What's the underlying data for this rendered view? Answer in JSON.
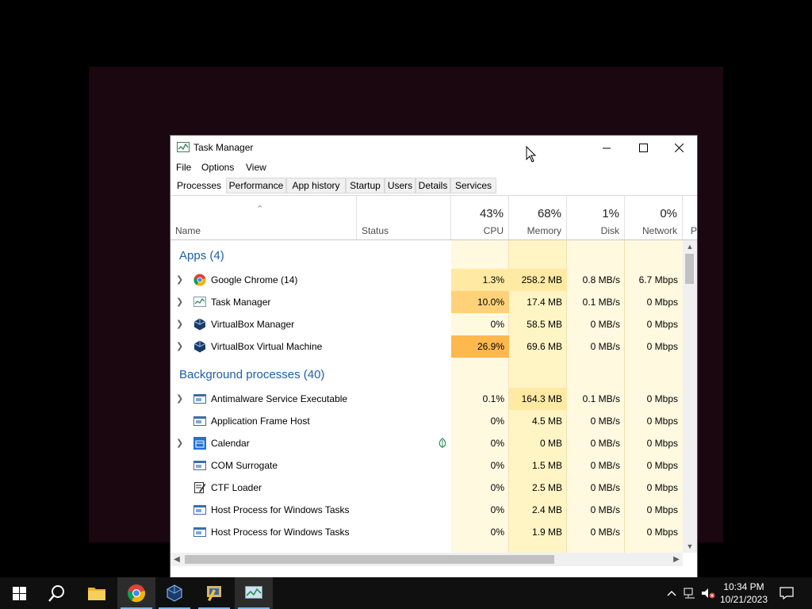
{
  "window": {
    "title": "Task Manager"
  },
  "menu": [
    "File",
    "Options",
    "View"
  ],
  "tabs": [
    "Processes",
    "Performance",
    "App history",
    "Startup",
    "Users",
    "Details",
    "Services"
  ],
  "columns": {
    "name": "Name",
    "status": "Status",
    "cpu": {
      "pct": "43%",
      "label": "CPU"
    },
    "memory": {
      "pct": "68%",
      "label": "Memory"
    },
    "disk": {
      "pct": "1%",
      "label": "Disk"
    },
    "network": {
      "pct": "0%",
      "label": "Network"
    },
    "power_partial": "P"
  },
  "groups": {
    "apps": "Apps (4)",
    "background": "Background processes (40)"
  },
  "apps": [
    {
      "name": "Google Chrome (14)",
      "icon": "chrome-icon",
      "cpu": "1.3%",
      "mem": "258.2 MB",
      "disk": "0.8 MB/s",
      "net": "6.7 Mbps"
    },
    {
      "name": "Task Manager",
      "icon": "task-manager-icon",
      "cpu": "10.0%",
      "mem": "17.4 MB",
      "disk": "0.1 MB/s",
      "net": "0 Mbps"
    },
    {
      "name": "VirtualBox Manager",
      "icon": "virtualbox-icon",
      "cpu": "0%",
      "mem": "58.5 MB",
      "disk": "0 MB/s",
      "net": "0 Mbps"
    },
    {
      "name": "VirtualBox Virtual Machine",
      "icon": "virtualbox-icon",
      "cpu": "26.9%",
      "mem": "69.6 MB",
      "disk": "0 MB/s",
      "net": "0 Mbps"
    }
  ],
  "background": [
    {
      "name": "Antimalware Service Executable",
      "icon": "service-window-icon",
      "cpu": "0.1%",
      "mem": "164.3 MB",
      "disk": "0.1 MB/s",
      "net": "0 Mbps"
    },
    {
      "name": "Application Frame Host",
      "icon": "service-window-icon",
      "cpu": "0%",
      "mem": "4.5 MB",
      "disk": "0 MB/s",
      "net": "0 Mbps"
    },
    {
      "name": "Calendar",
      "icon": "calendar-icon",
      "cpu": "0%",
      "mem": "0 MB",
      "disk": "0 MB/s",
      "net": "0 Mbps"
    },
    {
      "name": "COM Surrogate",
      "icon": "service-window-icon",
      "cpu": "0%",
      "mem": "1.5 MB",
      "disk": "0 MB/s",
      "net": "0 Mbps"
    },
    {
      "name": "CTF Loader",
      "icon": "ctf-loader-icon",
      "cpu": "0%",
      "mem": "2.5 MB",
      "disk": "0 MB/s",
      "net": "0 Mbps"
    },
    {
      "name": "Host Process for Windows Tasks",
      "icon": "service-window-icon",
      "cpu": "0%",
      "mem": "2.4 MB",
      "disk": "0 MB/s",
      "net": "0 Mbps"
    },
    {
      "name": "Host Process for Windows Tasks",
      "icon": "service-window-icon",
      "cpu": "0%",
      "mem": "1.9 MB",
      "disk": "0 MB/s",
      "net": "0 Mbps"
    }
  ],
  "clock": {
    "time": "10:34 PM",
    "date": "10/21/2023"
  },
  "colors": {
    "heat_low": "#fff4c4",
    "heat_mid": "#ffe9a3",
    "heat_high": "#ffd27a",
    "heat_hot": "#ffb84d",
    "group_text": "#1e5fa8",
    "taskbar": "#101010"
  }
}
